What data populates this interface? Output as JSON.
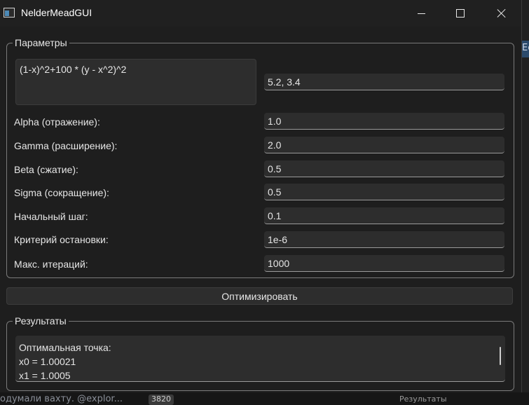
{
  "window": {
    "title": "NelderMeadGUI"
  },
  "background": {
    "right_tab_text": "Ec",
    "bottom_text": "одумали вахту. @explor...",
    "bottom_badge": "3820",
    "bottom_right_text": "Результаты"
  },
  "params": {
    "group_title": "Параметры",
    "function": "(1-x)^2+100 * (y - x^2)^2",
    "start_point": "5.2, 3.4",
    "rows": [
      {
        "label": "Alpha (отражение):",
        "value": "1.0"
      },
      {
        "label": "Gamma (расширение):",
        "value": "2.0"
      },
      {
        "label": "Beta (сжатие):",
        "value": "0.5"
      },
      {
        "label": "Sigma (сокращение):",
        "value": "0.5"
      },
      {
        "label": "Начальный шаг:",
        "value": "0.1"
      },
      {
        "label": "Критерий остановки:",
        "value": "1e-6"
      },
      {
        "label": "Макс. итераций:",
        "value": "1000"
      }
    ]
  },
  "optimize_button": {
    "label": "Оптимизировать"
  },
  "results": {
    "group_title": "Результаты",
    "lines": [
      "Оптимальная точка:",
      "x0 = 1.00021",
      "x1 = 1.0005"
    ]
  },
  "colors": {
    "window_bg": "#1e1e1e",
    "titlebar_bg": "#202020",
    "field_bg": "#2d2d2d",
    "groupbox_border": "#7a7a7a"
  }
}
